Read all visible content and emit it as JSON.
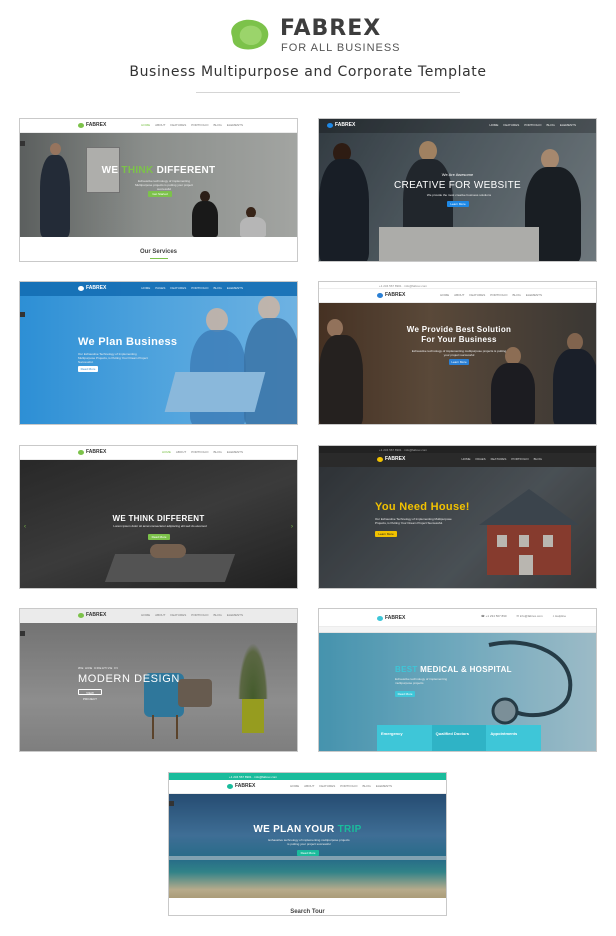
{
  "brand": {
    "name": "FABREX",
    "subtitle": "FOR  ALL BUSINESS",
    "tagline": "Business Multipurpose and Corporate Template",
    "logo_color": "#7cc24a"
  },
  "demos": [
    {
      "nav_logo": "FABREX",
      "title_pre": "WE ",
      "title_accent": "THINK",
      "title_post": " DIFFERENT",
      "accent": "#7cc24a",
      "button": "Get Started",
      "footer_label": "Our Services"
    },
    {
      "nav_logo": "FABREX",
      "kicker": "We Are Awesome",
      "title": "CREATIVE FOR WEBSITE",
      "accent": "#1e88e5",
      "button": "Learn More"
    },
    {
      "nav_logo": "FABREX",
      "title": "We Plan Business",
      "body": "Our Exhaustive Technology of Implementing Multipurpose Projects, is Putting Your Dream Project Successful.",
      "accent": "#3a8fd0",
      "button": "Read More"
    },
    {
      "nav_logo": "FABREX",
      "title": "We Provide Best Solution For Your Business",
      "accent": "#2a7fd4",
      "button": "Learn More"
    },
    {
      "nav_logo": "FABREX",
      "title": "WE THINK DIFFERENT",
      "accent": "#7cc24a",
      "button": "Read More"
    },
    {
      "nav_logo": "FABREX",
      "title": "You Need House!",
      "body": "Our Exhaustive Technology of Implementing Multipurpose Projects, is Putting Your Dream Project Successful.",
      "accent": "#f2c200",
      "button": "Learn More"
    },
    {
      "nav_logo": "FABREX",
      "kicker": "WE ARE CREATIVE IN",
      "title": "MODERN DESIGN",
      "button": "VIEW PROJECT"
    },
    {
      "nav_logo": "FABREX",
      "title_accent": "BEST",
      "title_post": " MEDICAL & HOSPITAL",
      "accent": "#3ec6d8",
      "button": "Read More",
      "features": [
        "Emergency",
        "Qualified Doctors",
        "Appointments"
      ]
    },
    {
      "nav_logo": "FABREX",
      "title_pre": "WE PLAN YOUR ",
      "title_accent": "TRIP",
      "accent": "#1abc9c",
      "button": "Read More",
      "footer_label": "Search Tour"
    }
  ]
}
